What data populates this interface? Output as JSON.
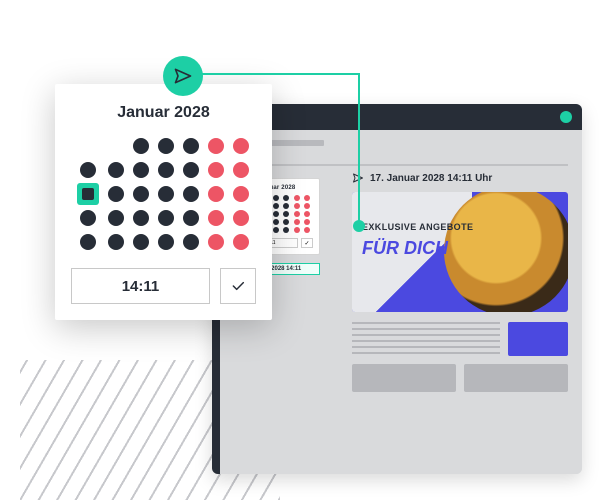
{
  "colors": {
    "accent": "#1dcfa5",
    "dark": "#272d37",
    "red": "#ed5565",
    "brandblue": "#4b49e0"
  },
  "icons": {
    "send": "send-icon",
    "check": "check-icon",
    "avatar": "avatar-dot"
  },
  "calendar": {
    "title": "Januar 2028",
    "days": [
      "blank",
      "blank",
      "d",
      "d",
      "d",
      "r",
      "r",
      "d",
      "d",
      "d",
      "d",
      "d",
      "r",
      "r",
      "sel",
      "d",
      "d",
      "d",
      "d",
      "r",
      "r",
      "d",
      "d",
      "d",
      "d",
      "d",
      "r",
      "r",
      "d",
      "d",
      "d",
      "d",
      "d",
      "r",
      "r"
    ],
    "time": "14:11"
  },
  "window": {
    "mini_calendar": {
      "title": "Januar 2028",
      "days": [
        "blank",
        "blank",
        "d",
        "d",
        "d",
        "r",
        "r",
        "d",
        "d",
        "d",
        "d",
        "d",
        "r",
        "r",
        "sel",
        "d",
        "d",
        "d",
        "d",
        "r",
        "r",
        "d",
        "d",
        "d",
        "d",
        "d",
        "r",
        "r",
        "d",
        "d",
        "d",
        "d",
        "d",
        "r",
        "r"
      ],
      "time": "14:11"
    },
    "scheduled_pill": "17. 01.2028  14:11",
    "preview": {
      "date_line": "17. Januar 2028  14:11 Uhr",
      "headline_small": "EXKLUSIVE ANGEBOTE",
      "headline_big": "FÜR DICH"
    }
  }
}
